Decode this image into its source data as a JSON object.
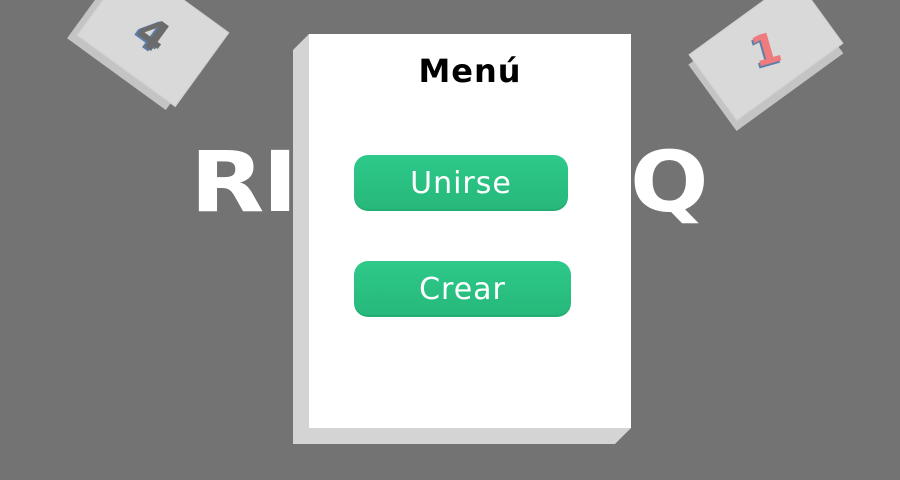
{
  "background": {
    "color": "#737373",
    "logo_left": "RI",
    "logo_right": "Q"
  },
  "cards": {
    "left_value": "4",
    "right_value": "1"
  },
  "menu": {
    "title": "Menú",
    "join_label": "Unirse",
    "create_label": "Crear",
    "button_color": "#2ec98a"
  }
}
